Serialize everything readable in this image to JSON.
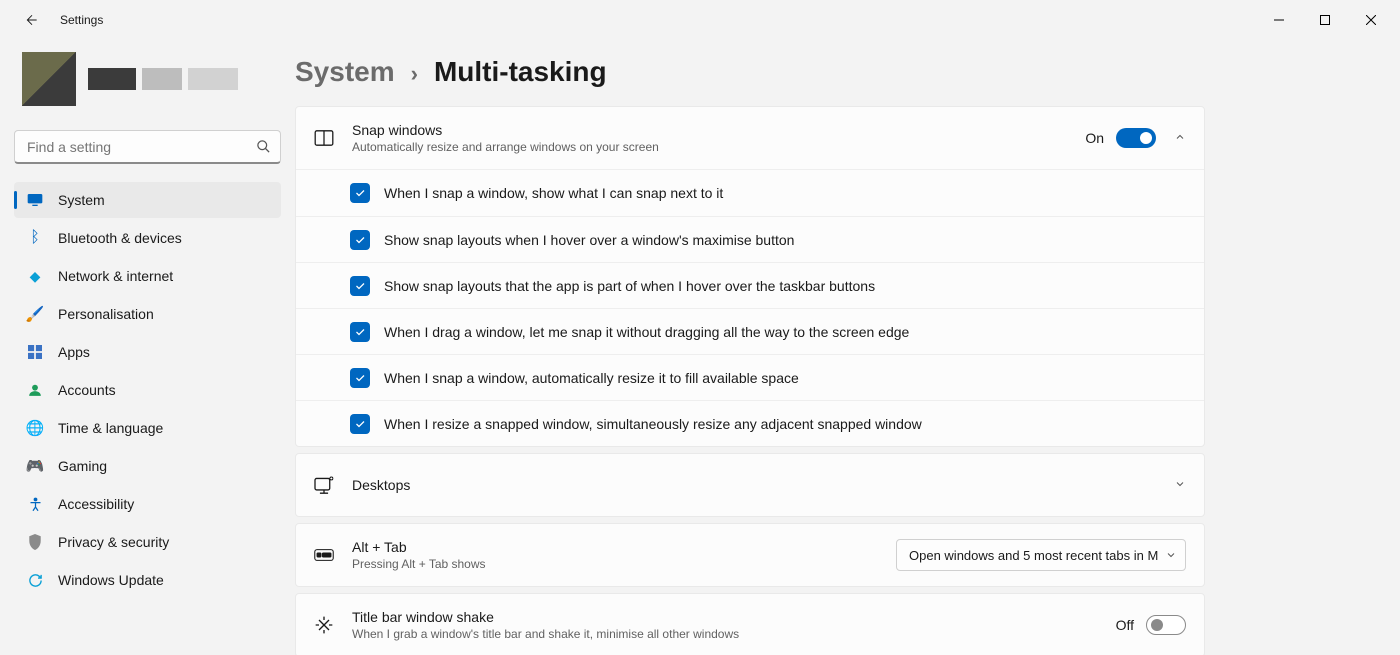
{
  "window": {
    "app_title": "Settings"
  },
  "search": {
    "placeholder": "Find a setting"
  },
  "sidebar": {
    "items": [
      {
        "label": "System",
        "icon": "system",
        "selected": true
      },
      {
        "label": "Bluetooth & devices",
        "icon": "bluetooth"
      },
      {
        "label": "Network & internet",
        "icon": "network"
      },
      {
        "label": "Personalisation",
        "icon": "personalisation"
      },
      {
        "label": "Apps",
        "icon": "apps"
      },
      {
        "label": "Accounts",
        "icon": "accounts"
      },
      {
        "label": "Time & language",
        "icon": "time"
      },
      {
        "label": "Gaming",
        "icon": "gaming"
      },
      {
        "label": "Accessibility",
        "icon": "accessibility"
      },
      {
        "label": "Privacy & security",
        "icon": "privacy"
      },
      {
        "label": "Windows Update",
        "icon": "update"
      }
    ]
  },
  "breadcrumbs": {
    "parent": "System",
    "current": "Multi-tasking"
  },
  "snap_windows": {
    "title": "Snap windows",
    "subtitle": "Automatically resize and arrange windows on your screen",
    "state_label": "On",
    "state_on": true,
    "expanded": true,
    "options": [
      {
        "checked": true,
        "label": "When I snap a window, show what I can snap next to it"
      },
      {
        "checked": true,
        "label": "Show snap layouts when I hover over a window's maximise button"
      },
      {
        "checked": true,
        "label": "Show snap layouts that the app is part of when I hover over the taskbar buttons"
      },
      {
        "checked": true,
        "label": "When I drag a window, let me snap it without dragging all the way to the screen edge"
      },
      {
        "checked": true,
        "label": "When I snap a window, automatically resize it to fill available space"
      },
      {
        "checked": true,
        "label": "When I resize a snapped window, simultaneously resize any adjacent snapped window"
      }
    ]
  },
  "desktops": {
    "title": "Desktops"
  },
  "alt_tab": {
    "title": "Alt + Tab",
    "subtitle": "Pressing Alt + Tab shows",
    "selected": "Open windows and 5 most recent tabs in M"
  },
  "title_bar_shake": {
    "title": "Title bar window shake",
    "subtitle": "When I grab a window's title bar and shake it, minimise all other windows",
    "state_label": "Off",
    "state_on": false
  }
}
